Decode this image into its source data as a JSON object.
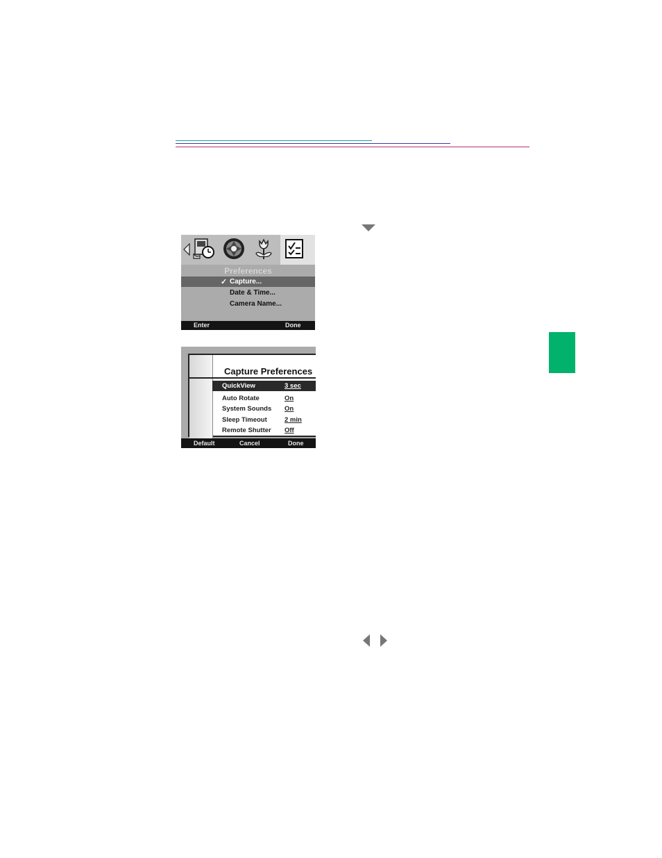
{
  "colors": {
    "rule_1": "#1f9a9a",
    "rule_2": "#3a3aa0",
    "rule_3": "#b0307a",
    "section_tab": "#00b26b"
  },
  "icons": [
    "down-arrow-icon",
    "left-arrow-icon",
    "right-arrow-icon",
    "review-clock-icon",
    "aperture-icon",
    "flower-icon",
    "checklist-icon"
  ],
  "screen1": {
    "title": "Preferences",
    "items": [
      {
        "label": "Capture...",
        "checked": true,
        "selected": true
      },
      {
        "label": "Date & Time..."
      },
      {
        "label": "Camera Name..."
      }
    ],
    "footer": {
      "left": "Enter",
      "right": "Done"
    }
  },
  "screen2": {
    "title": "Capture Preferences",
    "rows": [
      {
        "label": "QuickView",
        "value": "3 sec"
      },
      {
        "label": "Auto Rotate",
        "value": "On"
      },
      {
        "label": "System Sounds",
        "value": "On"
      },
      {
        "label": "Sleep Timeout",
        "value": "2 min"
      },
      {
        "label": "Remote Shutter",
        "value": "Off"
      }
    ],
    "footer": {
      "left": "Default",
      "middle": "Cancel",
      "right": "Done"
    }
  }
}
